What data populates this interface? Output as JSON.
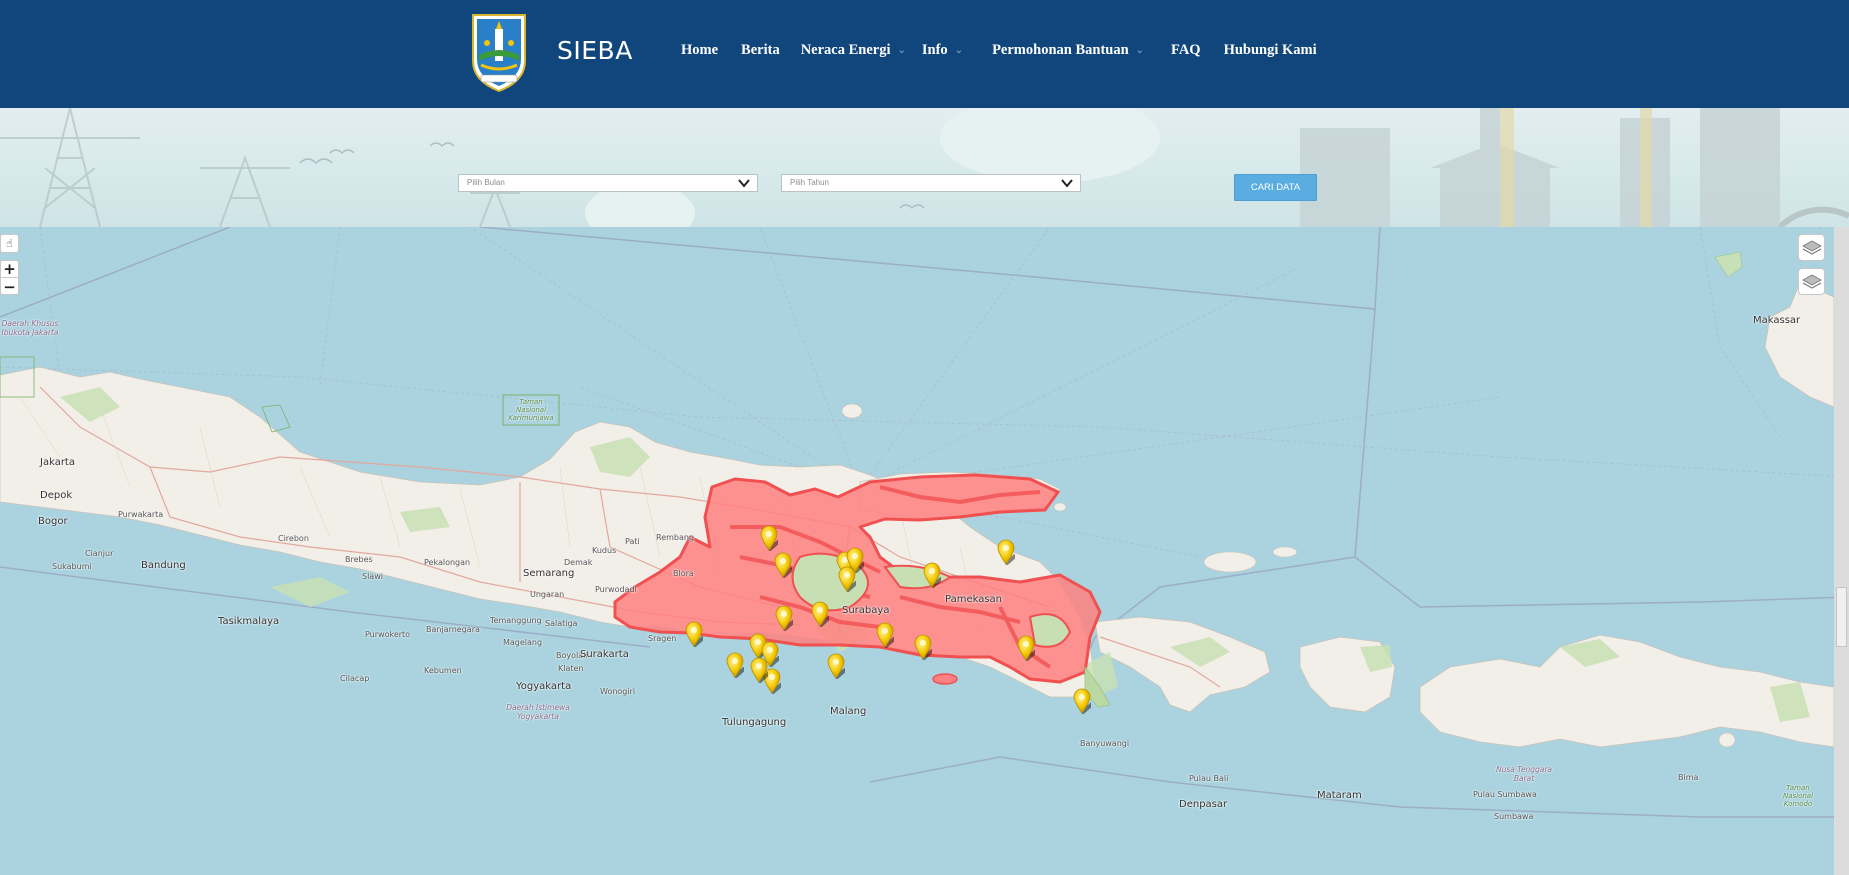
{
  "header": {
    "brand": "SIEBA",
    "nav": [
      {
        "label": "Home",
        "has_dropdown": false
      },
      {
        "label": "Berita",
        "has_dropdown": false
      },
      {
        "label": "Neraca Energi",
        "has_dropdown": true
      },
      {
        "label": "Info",
        "has_dropdown": true
      },
      {
        "label": "Permohonan Bantuan",
        "has_dropdown": true
      },
      {
        "label": "FAQ",
        "has_dropdown": false
      },
      {
        "label": "Hubungi Kami",
        "has_dropdown": false
      }
    ]
  },
  "filters": {
    "month_placeholder": "Pilih Bulan",
    "year_placeholder": "Pilih Tahun",
    "search_button": "CARI DATA"
  },
  "map": {
    "controls": {
      "zoom_in": "+",
      "zoom_out": "−"
    },
    "places": [
      {
        "name": "Jakarta",
        "cls": ""
      },
      {
        "name": "Depok",
        "cls": ""
      },
      {
        "name": "Bogor",
        "cls": ""
      },
      {
        "name": "Purwakarta",
        "cls": "small"
      },
      {
        "name": "Cianjur",
        "cls": "small"
      },
      {
        "name": "Sukabumi",
        "cls": "small"
      },
      {
        "name": "Bandung",
        "cls": ""
      },
      {
        "name": "Tasikmalaya",
        "cls": ""
      },
      {
        "name": "Cirebon",
        "cls": "small"
      },
      {
        "name": "Brebes",
        "cls": "small"
      },
      {
        "name": "Pekalongan",
        "cls": "small"
      },
      {
        "name": "Slawi",
        "cls": "small"
      },
      {
        "name": "Purwokerto",
        "cls": "small"
      },
      {
        "name": "Cilacap",
        "cls": "small"
      },
      {
        "name": "Semarang",
        "cls": ""
      },
      {
        "name": "Ungaran",
        "cls": "small"
      },
      {
        "name": "Kudus",
        "cls": "small"
      },
      {
        "name": "Demak",
        "cls": "small"
      },
      {
        "name": "Pati",
        "cls": "small"
      },
      {
        "name": "Rembang",
        "cls": "small"
      },
      {
        "name": "Blora",
        "cls": "small"
      },
      {
        "name": "Purwodadi",
        "cls": "small"
      },
      {
        "name": "Temanggung",
        "cls": "small"
      },
      {
        "name": "Salatiga",
        "cls": "small"
      },
      {
        "name": "Banjarnegara",
        "cls": "small"
      },
      {
        "name": "Magelang",
        "cls": "small"
      },
      {
        "name": "Boyolali",
        "cls": "small"
      },
      {
        "name": "Kebumen",
        "cls": "small"
      },
      {
        "name": "Surakarta",
        "cls": ""
      },
      {
        "name": "Sragen",
        "cls": "small"
      },
      {
        "name": "Klaten",
        "cls": "small"
      },
      {
        "name": "Yogyakarta",
        "cls": ""
      },
      {
        "name": "Wonogiri",
        "cls": "small"
      },
      {
        "name": "Tulungagung",
        "cls": ""
      },
      {
        "name": "Malang",
        "cls": ""
      },
      {
        "name": "Surabaya",
        "cls": ""
      },
      {
        "name": "Pamekasan",
        "cls": ""
      },
      {
        "name": "Banyuwangi",
        "cls": "small"
      },
      {
        "name": "Pulau Bali",
        "cls": "small"
      },
      {
        "name": "Denpasar",
        "cls": ""
      },
      {
        "name": "Mataram",
        "cls": ""
      },
      {
        "name": "Pulau Sumbawa",
        "cls": "small"
      },
      {
        "name": "Sumbawa",
        "cls": "small"
      },
      {
        "name": "Bima",
        "cls": "small"
      },
      {
        "name": "Makassar",
        "cls": ""
      },
      {
        "name": "Nusa Tenggara Barat",
        "cls": "region"
      },
      {
        "name": "Daerah Khusus Ibukota Jakarta",
        "cls": "region"
      },
      {
        "name": "Daerah Istimewa Yogyakarta",
        "cls": "region"
      },
      {
        "name": "Taman Nasional Karimunjawa",
        "cls": "park"
      },
      {
        "name": "Taman Nasional Komodo",
        "cls": "park"
      }
    ],
    "colors": {
      "sea": "#aad3df",
      "land": "#f2efe9",
      "highlight_fill": "#ff7f7f",
      "highlight_stroke": "#f05a5a",
      "marker": "#f2c200"
    }
  }
}
